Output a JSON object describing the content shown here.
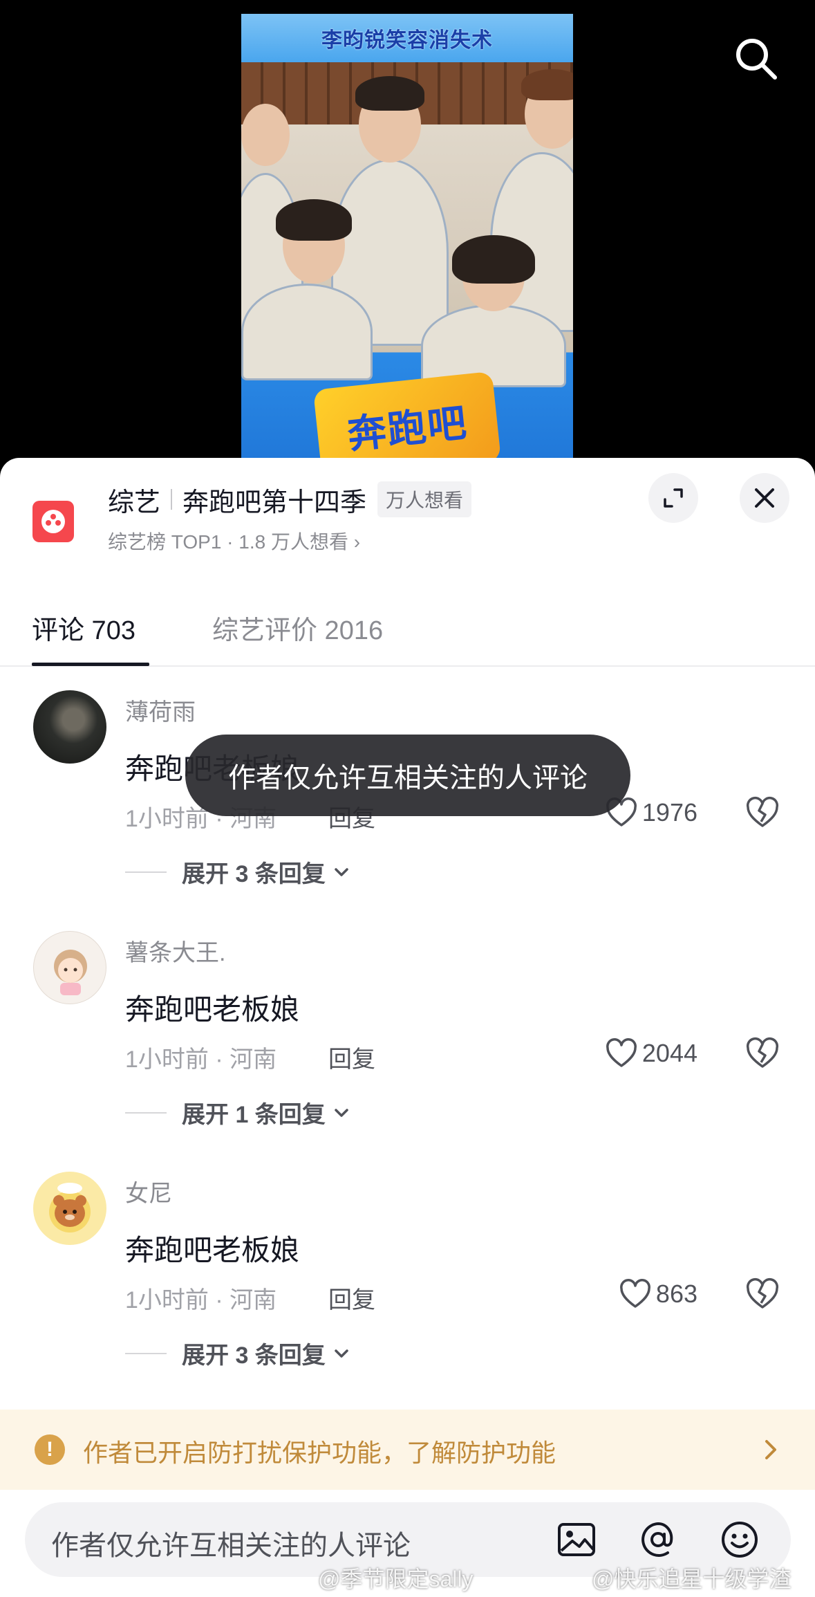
{
  "video": {
    "caption": "李昀锐笑容消失术",
    "show_logo_text": "奔跑吧"
  },
  "show": {
    "category": "综艺",
    "title": "奔跑吧第十四季",
    "badge": "万人想看",
    "subtitle": "综艺榜 TOP1 · 1.8 万人想看 ›"
  },
  "tabs": [
    {
      "label": "评论 703",
      "active": true
    },
    {
      "label": "综艺评价 2016",
      "active": false
    }
  ],
  "comments": [
    {
      "username": "薄荷雨",
      "text": "奔跑吧老板娘",
      "time": "1小时前 · 河南",
      "reply": "回复",
      "likes": "1976",
      "expand": "展开 3 条回复"
    },
    {
      "username": "薯条大王.",
      "text": "奔跑吧老板娘",
      "time": "1小时前 · 河南",
      "reply": "回复",
      "likes": "2044",
      "expand": "展开 1 条回复"
    },
    {
      "username": "女尼",
      "text": "奔跑吧老板娘",
      "time": "1小时前 · 河南",
      "reply": "回复",
      "likes": "863",
      "expand": "展开 3 条回复"
    }
  ],
  "toast": "作者仅允许互相关注的人评论",
  "notice": "作者已开启防打扰保护功能，了解防护功能",
  "input": {
    "placeholder": "作者仅允许互相关注的人评论"
  },
  "watermarks": [
    "@季节限定sally",
    "@快乐追星十级学渣"
  ],
  "colors": {
    "accent": "#f5474d",
    "notice_bg": "#fdf5e6",
    "notice_text": "#c08a3a"
  }
}
